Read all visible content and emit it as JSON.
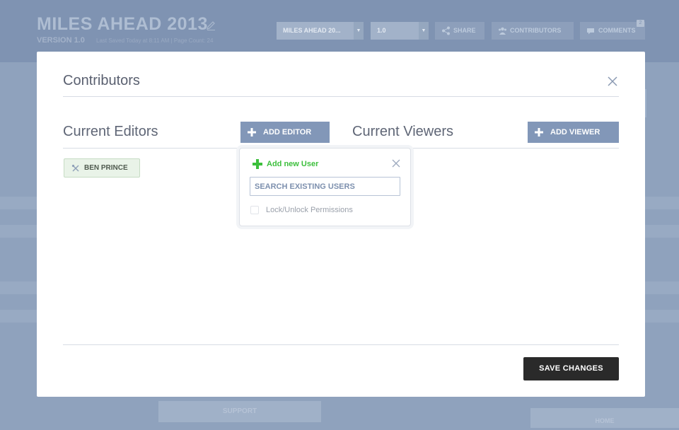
{
  "app_header": {
    "project_title": "MILES AHEAD 2013",
    "version": "VERSION 1.0",
    "meta": "Last Saved Today at 8:11 AM | Page Count: 24",
    "project_select": "MILES AHEAD 20...",
    "version_select": "1.0",
    "share_label": "SHARE",
    "contributors_label": "CONTRIBUTORS",
    "comments_label": "COMMENTS",
    "comments_count": "2"
  },
  "background": {
    "support_label": "SUPPORT",
    "home_label": "HOME"
  },
  "modal": {
    "title": "Contributors",
    "editors": {
      "title": "Current Editors",
      "add_label": "ADD EDITOR",
      "users": [
        "BEN PRINCE"
      ]
    },
    "viewers": {
      "title": "Current Viewers",
      "add_label": "ADD VIEWER"
    },
    "popover": {
      "add_new_user": "Add new User",
      "search_placeholder": "SEARCH EXISTING USERS",
      "lock_label": "Lock/Unlock Permissions"
    },
    "save_label": "SAVE CHANGES"
  },
  "colors": {
    "overlay": "#8fa2bd",
    "header": "#7f93b2",
    "accent_button": "#8297b8",
    "success_green": "#3cbf3c",
    "save_button": "#2a2a2a"
  },
  "icons": [
    "pencil-icon",
    "caret-down-icon",
    "share-icon",
    "users-icon",
    "comment-icon",
    "close-icon",
    "plus-icon",
    "wrench-icon",
    "checkbox-icon"
  ]
}
